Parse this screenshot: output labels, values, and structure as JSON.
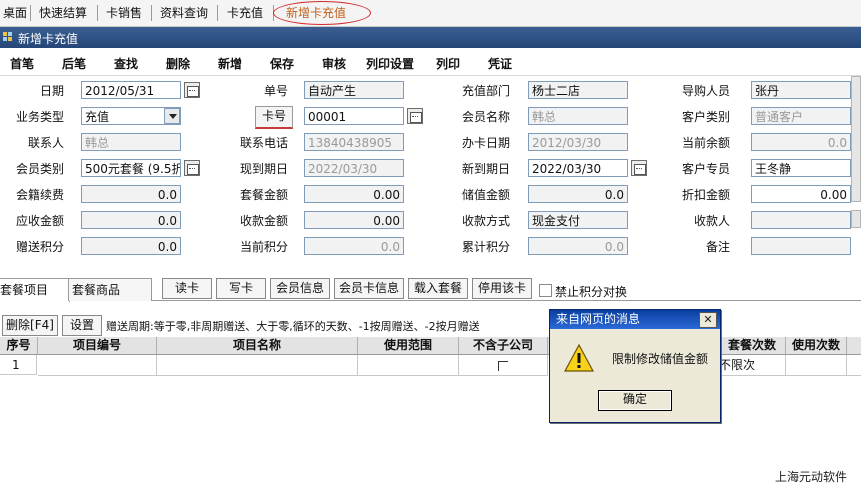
{
  "tabs": [
    "桌面",
    "快速结算",
    "卡销售",
    "资料查询",
    "卡充值",
    "新增卡充值"
  ],
  "window_title": "新增卡充值",
  "toolbar": [
    "首笔",
    "后笔",
    "查找",
    "删除",
    "新增",
    "保存",
    "审核",
    "列印设置",
    "列印",
    "凭证"
  ],
  "form": {
    "date_label": "日期",
    "date_value": "2012/05/31",
    "docno_label": "单号",
    "docno_value": "自动产生",
    "dept_label": "充值部门",
    "dept_value": "杨士二店",
    "guide_label": "导购人员",
    "guide_value": "张丹",
    "biztype_label": "业务类型",
    "biztype_value": "充值",
    "card_button": "卡号",
    "card_value": "00001",
    "member_name_label": "会员名称",
    "member_name_value": "韩总",
    "cust_type_label": "客户类别",
    "cust_type_value": "普通客户",
    "contact_label": "联系人",
    "contact_value": "韩总",
    "phone_label": "联系电话",
    "phone_value": "13840438905",
    "issue_date_label": "办卡日期",
    "issue_date_value": "2012/03/30",
    "balance_label": "当前余额",
    "balance_value": "0.0",
    "member_type_label": "会员类别",
    "member_type_value": "500元套餐 (9.5折",
    "expiry_label": "现到期日",
    "expiry_value": "2022/03/30",
    "new_expiry_label": "新到期日",
    "new_expiry_value": "2022/03/30",
    "cust_rep_label": "客户专员",
    "cust_rep_value": "王冬静",
    "renew_fee_label": "会籍续费",
    "renew_fee_value": "0.0",
    "pkg_amount_label": "套餐金额",
    "pkg_amount_value": "0.00",
    "stored_value_label": "储值金额",
    "stored_value_value": "0.0",
    "discount_amount_label": "折扣金额",
    "discount_amount_value": "0.00",
    "receivable_label": "应收金额",
    "receivable_value": "0.0",
    "received_label": "收款金额",
    "received_value": "0.00",
    "pay_method_label": "收款方式",
    "pay_method_value": "现金支付",
    "payee_label": "收款人",
    "payee_value": "",
    "gift_points_label": "赠送积分",
    "gift_points_value": "0.0",
    "current_points_label": "当前积分",
    "current_points_value": "0.0",
    "accum_points_label": "累计积分",
    "accum_points_value": "0.0",
    "remark_label": "备注",
    "remark_value": ""
  },
  "subtabs": [
    "套餐项目",
    "套餐商品"
  ],
  "actions": [
    "读卡",
    "写卡",
    "会员信息",
    "会员卡信息",
    "载入套餐",
    "停用该卡"
  ],
  "disable_points_label": "禁止积分对换",
  "grid_toolbar": {
    "delete": "删除[F4]",
    "settings": "设置",
    "hint": "赠送周期:等于零,非周期赠送、大于零,循环的天数、-1按周赠送、-2按月赠送"
  },
  "grid": {
    "headers": [
      "序号",
      "项目编号",
      "项目名称",
      "使用范围",
      "不含子公司",
      "",
      "套餐次数",
      "使用次数"
    ],
    "row": {
      "no": "1",
      "times": "不限次"
    }
  },
  "dialog": {
    "title": "来自网页的消息",
    "close": "✕",
    "message": "限制修改储值金额",
    "ok": "确定",
    "icon": "warning-icon"
  },
  "footer": "上海元动软件"
}
